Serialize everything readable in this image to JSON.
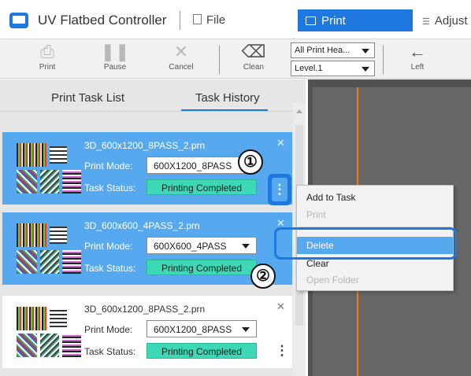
{
  "app": {
    "title": "UV Flatbed Controller",
    "menu_file": "File",
    "tab_print": "Print",
    "tab_adjust": "Adjust",
    "icons": {
      "app": "app-monitor-icon",
      "file": "file-icon",
      "print": "printer-icon",
      "adjust": "adjust-icon"
    }
  },
  "toolbar": {
    "print": "Print",
    "pause": "Pause",
    "cancel": "Cancel",
    "clean": "Clean",
    "left": "Left",
    "head_select": "All Print Hea...",
    "level_select": "Level.1"
  },
  "tabs": {
    "task_list": "Print Task List",
    "task_history": "Task History"
  },
  "labels": {
    "print_mode": "Print Mode:",
    "task_status": "Task Status:"
  },
  "tasks": [
    {
      "file": "3D_600x1200_8PASS_2.prn",
      "mode": "600X1200_8PASS",
      "status": "Printing Completed",
      "selected": true
    },
    {
      "file": "3D_600x600_4PASS_2.prn",
      "mode": "600X600_4PASS",
      "status": "Printing Completed",
      "selected": true
    },
    {
      "file": "3D_600x1200_8PASS_2.prn",
      "mode": "600X1200_8PASS",
      "status": "Printing Completed",
      "selected": false
    }
  ],
  "context_menu": {
    "add_to_task": "Add to Task",
    "print": "Print",
    "delete": "Delete",
    "clear": "Clear",
    "open_folder": "Open Folder"
  },
  "callouts": {
    "one": "①",
    "two": "②"
  },
  "colors": {
    "accent": "#1f78e0",
    "selected_card": "#56a9ee",
    "status_done": "#3dd9b6",
    "guide_line": "#f07b17"
  }
}
